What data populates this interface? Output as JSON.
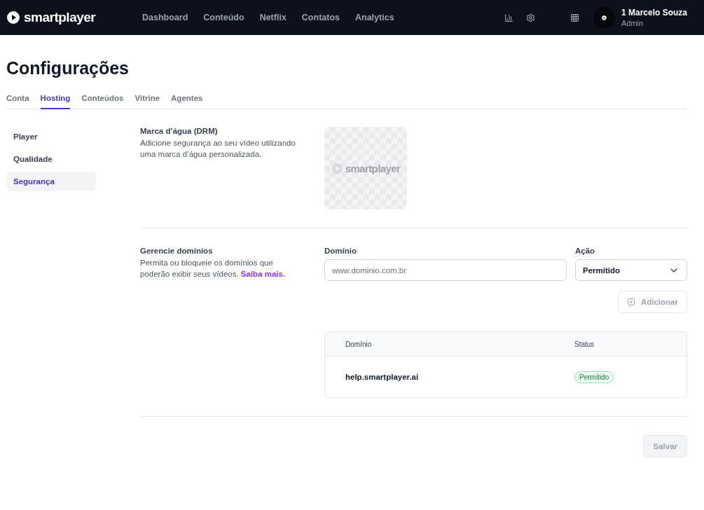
{
  "header": {
    "logo": "smartplayer",
    "nav": [
      {
        "label": "Dashboard"
      },
      {
        "label": "Conteúdo"
      },
      {
        "label": "Netflix"
      },
      {
        "label": "Contatos"
      },
      {
        "label": "Analytics"
      }
    ],
    "user": {
      "name": "1 Marcelo Souza",
      "role": "Admin"
    }
  },
  "page": {
    "title": "Configurações"
  },
  "tabs": [
    {
      "label": "Conta",
      "selected": false
    },
    {
      "label": "Hosting",
      "selected": true
    },
    {
      "label": "Conteúdos",
      "selected": false
    },
    {
      "label": "Vitrine",
      "selected": false
    },
    {
      "label": "Agentes",
      "selected": false
    }
  ],
  "sidebar": {
    "items": [
      {
        "label": "Player",
        "selected": false
      },
      {
        "label": "Qualidade",
        "selected": false
      },
      {
        "label": "Segurança",
        "selected": true
      }
    ]
  },
  "watermark": {
    "title": "Marca d’água (DRM)",
    "description": "Adicione segurança ao seu vídeo utilizando uma marca d’água personalizada.",
    "preview_text": "smartplayer"
  },
  "domains": {
    "title": "Gerencie domínios",
    "description": "Permita ou bloqueie os domínios que poderão exibir seus vídeos.",
    "link": "Saiba mais.",
    "domain_label": "Domínio",
    "domain_placeholder": "www.dominio.com.br",
    "action_label": "Ação",
    "action_value": "Permitido",
    "add_button": {
      "label": "Adicionar",
      "disabled": true
    },
    "table": {
      "columns": [
        "Domínio",
        "Status"
      ],
      "rows": [
        {
          "domain": "help.smartplayer.ai",
          "status": "Permitido",
          "kind": "allowed"
        }
      ]
    }
  },
  "save_button": {
    "label": "Salvar",
    "disabled": true
  }
}
